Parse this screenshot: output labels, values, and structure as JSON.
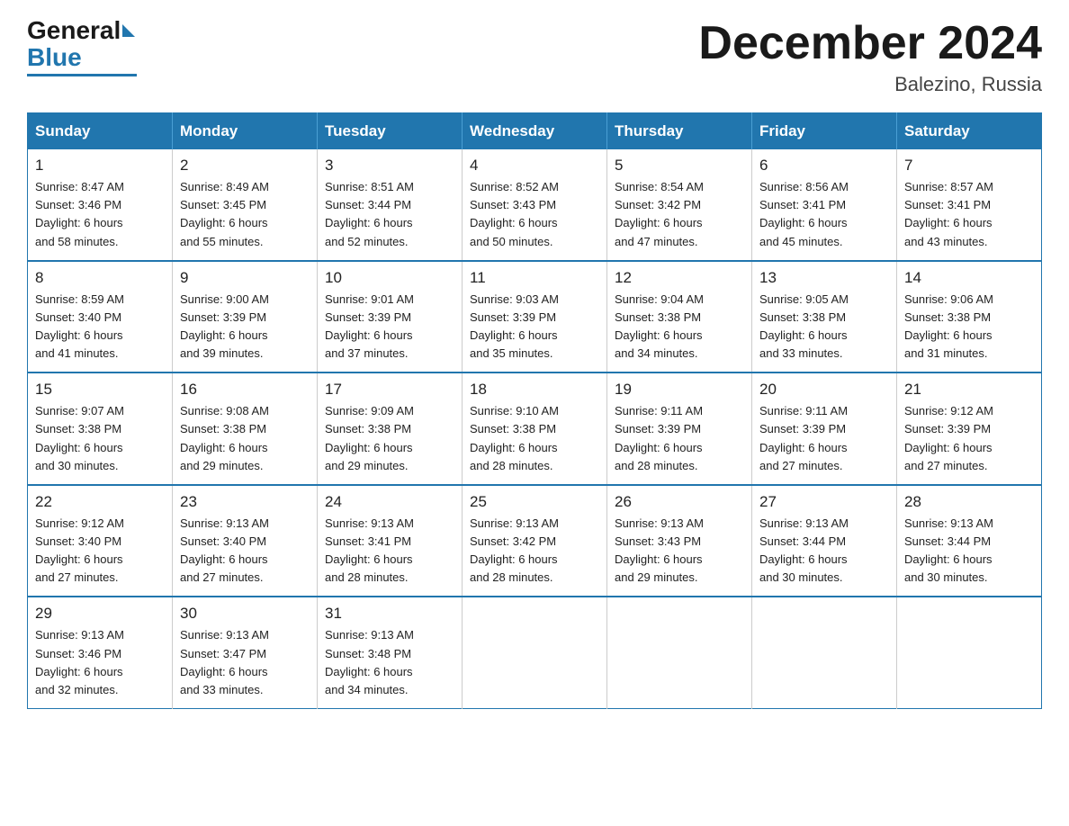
{
  "logo": {
    "general": "General",
    "blue": "Blue"
  },
  "title": "December 2024",
  "location": "Balezino, Russia",
  "days_header": [
    "Sunday",
    "Monday",
    "Tuesday",
    "Wednesday",
    "Thursday",
    "Friday",
    "Saturday"
  ],
  "weeks": [
    [
      {
        "day": "1",
        "sunrise": "8:47 AM",
        "sunset": "3:46 PM",
        "daylight": "6 hours and 58 minutes."
      },
      {
        "day": "2",
        "sunrise": "8:49 AM",
        "sunset": "3:45 PM",
        "daylight": "6 hours and 55 minutes."
      },
      {
        "day": "3",
        "sunrise": "8:51 AM",
        "sunset": "3:44 PM",
        "daylight": "6 hours and 52 minutes."
      },
      {
        "day": "4",
        "sunrise": "8:52 AM",
        "sunset": "3:43 PM",
        "daylight": "6 hours and 50 minutes."
      },
      {
        "day": "5",
        "sunrise": "8:54 AM",
        "sunset": "3:42 PM",
        "daylight": "6 hours and 47 minutes."
      },
      {
        "day": "6",
        "sunrise": "8:56 AM",
        "sunset": "3:41 PM",
        "daylight": "6 hours and 45 minutes."
      },
      {
        "day": "7",
        "sunrise": "8:57 AM",
        "sunset": "3:41 PM",
        "daylight": "6 hours and 43 minutes."
      }
    ],
    [
      {
        "day": "8",
        "sunrise": "8:59 AM",
        "sunset": "3:40 PM",
        "daylight": "6 hours and 41 minutes."
      },
      {
        "day": "9",
        "sunrise": "9:00 AM",
        "sunset": "3:39 PM",
        "daylight": "6 hours and 39 minutes."
      },
      {
        "day": "10",
        "sunrise": "9:01 AM",
        "sunset": "3:39 PM",
        "daylight": "6 hours and 37 minutes."
      },
      {
        "day": "11",
        "sunrise": "9:03 AM",
        "sunset": "3:39 PM",
        "daylight": "6 hours and 35 minutes."
      },
      {
        "day": "12",
        "sunrise": "9:04 AM",
        "sunset": "3:38 PM",
        "daylight": "6 hours and 34 minutes."
      },
      {
        "day": "13",
        "sunrise": "9:05 AM",
        "sunset": "3:38 PM",
        "daylight": "6 hours and 33 minutes."
      },
      {
        "day": "14",
        "sunrise": "9:06 AM",
        "sunset": "3:38 PM",
        "daylight": "6 hours and 31 minutes."
      }
    ],
    [
      {
        "day": "15",
        "sunrise": "9:07 AM",
        "sunset": "3:38 PM",
        "daylight": "6 hours and 30 minutes."
      },
      {
        "day": "16",
        "sunrise": "9:08 AM",
        "sunset": "3:38 PM",
        "daylight": "6 hours and 29 minutes."
      },
      {
        "day": "17",
        "sunrise": "9:09 AM",
        "sunset": "3:38 PM",
        "daylight": "6 hours and 29 minutes."
      },
      {
        "day": "18",
        "sunrise": "9:10 AM",
        "sunset": "3:38 PM",
        "daylight": "6 hours and 28 minutes."
      },
      {
        "day": "19",
        "sunrise": "9:11 AM",
        "sunset": "3:39 PM",
        "daylight": "6 hours and 28 minutes."
      },
      {
        "day": "20",
        "sunrise": "9:11 AM",
        "sunset": "3:39 PM",
        "daylight": "6 hours and 27 minutes."
      },
      {
        "day": "21",
        "sunrise": "9:12 AM",
        "sunset": "3:39 PM",
        "daylight": "6 hours and 27 minutes."
      }
    ],
    [
      {
        "day": "22",
        "sunrise": "9:12 AM",
        "sunset": "3:40 PM",
        "daylight": "6 hours and 27 minutes."
      },
      {
        "day": "23",
        "sunrise": "9:13 AM",
        "sunset": "3:40 PM",
        "daylight": "6 hours and 27 minutes."
      },
      {
        "day": "24",
        "sunrise": "9:13 AM",
        "sunset": "3:41 PM",
        "daylight": "6 hours and 28 minutes."
      },
      {
        "day": "25",
        "sunrise": "9:13 AM",
        "sunset": "3:42 PM",
        "daylight": "6 hours and 28 minutes."
      },
      {
        "day": "26",
        "sunrise": "9:13 AM",
        "sunset": "3:43 PM",
        "daylight": "6 hours and 29 minutes."
      },
      {
        "day": "27",
        "sunrise": "9:13 AM",
        "sunset": "3:44 PM",
        "daylight": "6 hours and 30 minutes."
      },
      {
        "day": "28",
        "sunrise": "9:13 AM",
        "sunset": "3:44 PM",
        "daylight": "6 hours and 30 minutes."
      }
    ],
    [
      {
        "day": "29",
        "sunrise": "9:13 AM",
        "sunset": "3:46 PM",
        "daylight": "6 hours and 32 minutes."
      },
      {
        "day": "30",
        "sunrise": "9:13 AM",
        "sunset": "3:47 PM",
        "daylight": "6 hours and 33 minutes."
      },
      {
        "day": "31",
        "sunrise": "9:13 AM",
        "sunset": "3:48 PM",
        "daylight": "6 hours and 34 minutes."
      },
      null,
      null,
      null,
      null
    ]
  ],
  "labels": {
    "sunrise": "Sunrise:",
    "sunset": "Sunset:",
    "daylight": "Daylight:"
  }
}
